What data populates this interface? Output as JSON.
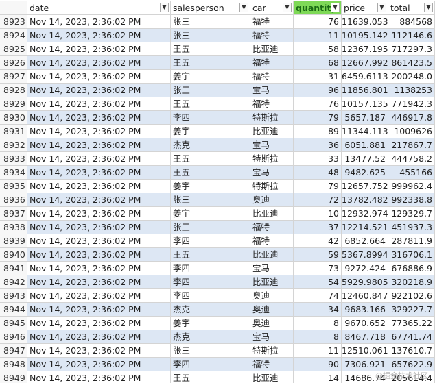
{
  "header": {
    "date": "date",
    "salesperson": "salesperson",
    "car": "car",
    "quantity": "quantity",
    "price": "price",
    "total": "total",
    "filter_icon": "dropdown-arrow"
  },
  "rows": [
    {
      "rownum": "8923",
      "date": "Nov 14, 2023, 2:36:02 PM",
      "salesperson": "张三",
      "car": "福特",
      "quantity": "76",
      "price": "11639.053",
      "total": "884568"
    },
    {
      "rownum": "8924",
      "date": "Nov 14, 2023, 2:36:02 PM",
      "salesperson": "张三",
      "car": "福特",
      "quantity": "11",
      "price": "10195.142",
      "total": "112146.6"
    },
    {
      "rownum": "8925",
      "date": "Nov 14, 2023, 2:36:02 PM",
      "salesperson": "王五",
      "car": "比亚迪",
      "quantity": "58",
      "price": "12367.195",
      "total": "717297.3"
    },
    {
      "rownum": "8926",
      "date": "Nov 14, 2023, 2:36:02 PM",
      "salesperson": "王五",
      "car": "福特",
      "quantity": "68",
      "price": "12667.992",
      "total": "861423.5"
    },
    {
      "rownum": "8927",
      "date": "Nov 14, 2023, 2:36:02 PM",
      "salesperson": "姜宇",
      "car": "福特",
      "quantity": "31",
      "price": "6459.6113",
      "total": "200248.0"
    },
    {
      "rownum": "8928",
      "date": "Nov 14, 2023, 2:36:02 PM",
      "salesperson": "张三",
      "car": "宝马",
      "quantity": "96",
      "price": "11856.801",
      "total": "1138253"
    },
    {
      "rownum": "8929",
      "date": "Nov 14, 2023, 2:36:02 PM",
      "salesperson": "王五",
      "car": "福特",
      "quantity": "76",
      "price": "10157.135",
      "total": "771942.3"
    },
    {
      "rownum": "8930",
      "date": "Nov 14, 2023, 2:36:02 PM",
      "salesperson": "李四",
      "car": "特斯拉",
      "quantity": "79",
      "price": "5657.187",
      "total": "446917.8"
    },
    {
      "rownum": "8931",
      "date": "Nov 14, 2023, 2:36:02 PM",
      "salesperson": "姜宇",
      "car": "比亚迪",
      "quantity": "89",
      "price": "11344.113",
      "total": "1009626"
    },
    {
      "rownum": "8932",
      "date": "Nov 14, 2023, 2:36:02 PM",
      "salesperson": "杰克",
      "car": "宝马",
      "quantity": "36",
      "price": "6051.881",
      "total": "217867.7"
    },
    {
      "rownum": "8933",
      "date": "Nov 14, 2023, 2:36:02 PM",
      "salesperson": "王五",
      "car": "特斯拉",
      "quantity": "33",
      "price": "13477.52",
      "total": "444758.2"
    },
    {
      "rownum": "8934",
      "date": "Nov 14, 2023, 2:36:02 PM",
      "salesperson": "王五",
      "car": "宝马",
      "quantity": "48",
      "price": "9482.625",
      "total": "455166"
    },
    {
      "rownum": "8935",
      "date": "Nov 14, 2023, 2:36:02 PM",
      "salesperson": "姜宇",
      "car": "特斯拉",
      "quantity": "79",
      "price": "12657.752",
      "total": "999962.4"
    },
    {
      "rownum": "8936",
      "date": "Nov 14, 2023, 2:36:02 PM",
      "salesperson": "张三",
      "car": "奥迪",
      "quantity": "72",
      "price": "13782.482",
      "total": "992338.8"
    },
    {
      "rownum": "8937",
      "date": "Nov 14, 2023, 2:36:02 PM",
      "salesperson": "姜宇",
      "car": "比亚迪",
      "quantity": "10",
      "price": "12932.974",
      "total": "129329.7"
    },
    {
      "rownum": "8938",
      "date": "Nov 14, 2023, 2:36:02 PM",
      "salesperson": "张三",
      "car": "福特",
      "quantity": "37",
      "price": "12214.521",
      "total": "451937.3"
    },
    {
      "rownum": "8939",
      "date": "Nov 14, 2023, 2:36:02 PM",
      "salesperson": "李四",
      "car": "福特",
      "quantity": "42",
      "price": "6852.664",
      "total": "287811.9"
    },
    {
      "rownum": "8940",
      "date": "Nov 14, 2023, 2:36:02 PM",
      "salesperson": "王五",
      "car": "比亚迪",
      "quantity": "59",
      "price": "5367.8994",
      "total": "316706.1"
    },
    {
      "rownum": "8941",
      "date": "Nov 14, 2023, 2:36:02 PM",
      "salesperson": "李四",
      "car": "宝马",
      "quantity": "73",
      "price": "9272.424",
      "total": "676886.9"
    },
    {
      "rownum": "8942",
      "date": "Nov 14, 2023, 2:36:02 PM",
      "salesperson": "李四",
      "car": "比亚迪",
      "quantity": "54",
      "price": "5929.9805",
      "total": "320218.9"
    },
    {
      "rownum": "8943",
      "date": "Nov 14, 2023, 2:36:02 PM",
      "salesperson": "李四",
      "car": "奥迪",
      "quantity": "74",
      "price": "12460.847",
      "total": "922102.6"
    },
    {
      "rownum": "8944",
      "date": "Nov 14, 2023, 2:36:02 PM",
      "salesperson": "杰克",
      "car": "奥迪",
      "quantity": "34",
      "price": "9683.166",
      "total": "329227.7"
    },
    {
      "rownum": "8945",
      "date": "Nov 14, 2023, 2:36:02 PM",
      "salesperson": "姜宇",
      "car": "奥迪",
      "quantity": "8",
      "price": "9670.652",
      "total": "77365.22"
    },
    {
      "rownum": "8946",
      "date": "Nov 14, 2023, 2:36:02 PM",
      "salesperson": "杰克",
      "car": "宝马",
      "quantity": "8",
      "price": "8467.718",
      "total": "67741.74"
    },
    {
      "rownum": "8947",
      "date": "Nov 14, 2023, 2:36:02 PM",
      "salesperson": "张三",
      "car": "特斯拉",
      "quantity": "11",
      "price": "12510.061",
      "total": "137610.7"
    },
    {
      "rownum": "8948",
      "date": "Nov 14, 2023, 2:36:02 PM",
      "salesperson": "李四",
      "car": "福特",
      "quantity": "90",
      "price": "7306.921",
      "total": "657622.9"
    },
    {
      "rownum": "8949",
      "date": "Nov 14, 2023, 2:36:02 PM",
      "salesperson": "王五",
      "car": "比亚迪",
      "quantity": "14",
      "price": "14686.74",
      "total": "205614.4"
    }
  ],
  "watermark": "@掘金技术社区",
  "colors": {
    "band": "#dde7f4",
    "active_filter": "#7ed957",
    "gridline": "#d4d4d4"
  }
}
